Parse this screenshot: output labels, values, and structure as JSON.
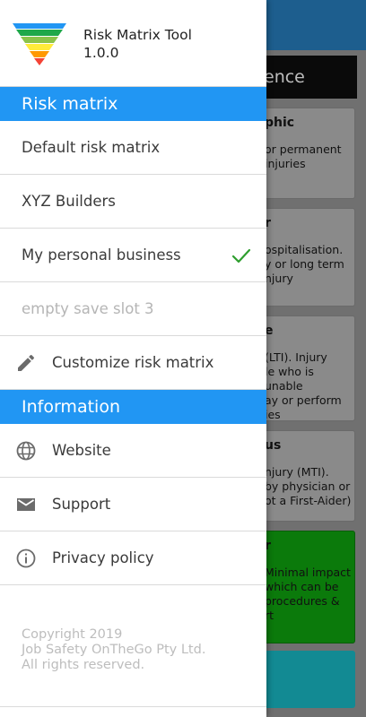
{
  "background": {
    "tab_label": "ence",
    "cards": [
      {
        "title": "phic",
        "body": [
          "or permanent",
          "injuries"
        ]
      },
      {
        "title": "r",
        "body": [
          "ospitalisation.",
          "y or long term",
          "njury"
        ]
      },
      {
        "title": "e",
        "body": [
          "(LTI). Injury",
          "le who is unable",
          "ay or perform",
          "ies"
        ]
      },
      {
        "title": "us",
        "body": [
          "njury (MTI).",
          "by physician or",
          "ot a First-Aider)"
        ]
      },
      {
        "title": "r",
        "body": [
          "Minimal impact",
          "which can be",
          "procedures &",
          "rt"
        ]
      }
    ]
  },
  "drawer": {
    "app_title": "Risk Matrix Tool",
    "app_version": "1.0.0",
    "risk_section": "Risk matrix",
    "risk_items": [
      {
        "label": "Default risk matrix"
      },
      {
        "label": "XYZ Builders"
      },
      {
        "label": "My personal business",
        "selected": true
      },
      {
        "label": "empty save slot 3",
        "disabled": true
      }
    ],
    "customize_label": "Customize risk matrix",
    "info_section": "Information",
    "info_items": [
      {
        "label": "Website",
        "icon": "globe-icon"
      },
      {
        "label": "Support",
        "icon": "mail-icon"
      },
      {
        "label": "Privacy policy",
        "icon": "info-icon"
      }
    ],
    "copyright": [
      "Copyright 2019",
      "Job Safety OnTheGo Pty Ltd.",
      "All rights reserved."
    ]
  },
  "colors": {
    "accent": "#2196f3",
    "check": "#2e9e2e",
    "card_green": "#0b7a0b",
    "card_teal": "#128a93"
  }
}
